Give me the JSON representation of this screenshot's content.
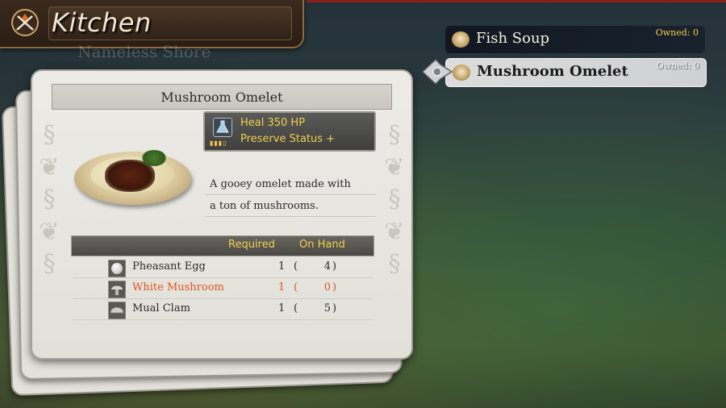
{
  "header": {
    "title": "Kitchen",
    "location_ghost": "Nameless Shore",
    "icon": "crossed-utensils-flame-icon"
  },
  "detail": {
    "dish_name": "Mushroom Omelet",
    "effects": [
      "Heal 350 HP",
      "Preserve Status +"
    ],
    "effect_icon": "flask-potion-icon",
    "description_lines": [
      "A gooey omelet made with",
      "a ton of mushrooms."
    ],
    "ingredients_header": {
      "required": "Required",
      "on_hand": "On Hand"
    },
    "ingredients": [
      {
        "name": "Pheasant Egg",
        "required": "1",
        "on_hand": "4",
        "lacking": false,
        "icon": "egg-icon"
      },
      {
        "name": "White Mushroom",
        "required": "1",
        "on_hand": "0",
        "lacking": true,
        "icon": "mushroom-icon"
      },
      {
        "name": "Mual Clam",
        "required": "1",
        "on_hand": "5",
        "lacking": false,
        "icon": "clam-icon"
      }
    ],
    "paren_open": "(",
    "paren_close": ")"
  },
  "recipes": [
    {
      "name": "Fish Soup",
      "owned": "Owned: 0",
      "selected": false
    },
    {
      "name": "Mushroom Omelet",
      "owned": "Owned: 0",
      "selected": true
    }
  ],
  "colors": {
    "accent_yellow": "#f2d04b",
    "lacking_orange": "#e1541d",
    "card_bg": "#ecebe6"
  }
}
